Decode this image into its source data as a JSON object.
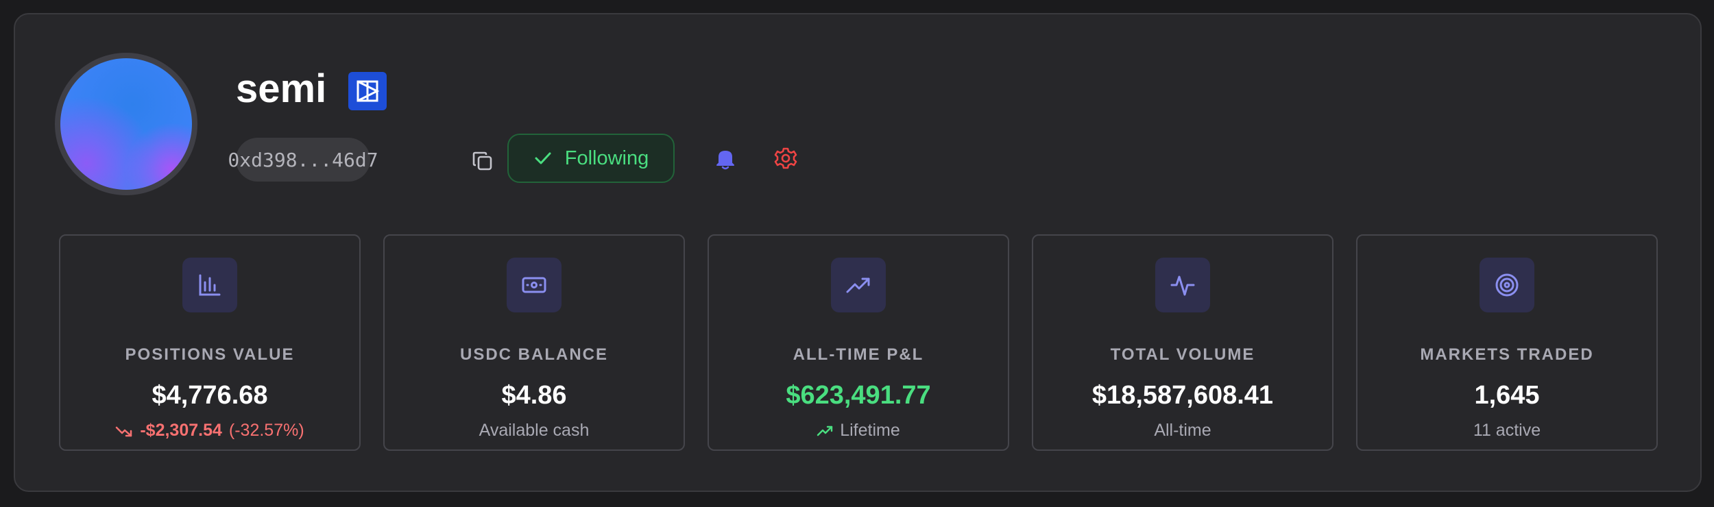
{
  "profile": {
    "name": "semi",
    "address": "0xd398...46d7",
    "follow_label": "Following",
    "icons": {
      "badge": "verified-platform-icon",
      "copy": "copy-icon",
      "follow_check": "check-icon",
      "notify": "bell-icon",
      "settings": "gear-icon"
    }
  },
  "stats": [
    {
      "icon": "bar-chart-icon",
      "label": "POSITIONS VALUE",
      "value": "$4,776.68",
      "change_amount": "-$2,307.54",
      "change_percent": "(-32.57%)",
      "change_icon": "trending-down-icon"
    },
    {
      "icon": "banknote-icon",
      "label": "USDC BALANCE",
      "value": "$4.86",
      "sub": "Available cash"
    },
    {
      "icon": "trending-up-icon",
      "label": "ALL-TIME P&L",
      "value": "$623,491.77",
      "sub": "Lifetime",
      "sub_icon": "trending-up-icon"
    },
    {
      "icon": "activity-icon",
      "label": "TOTAL VOLUME",
      "value": "$18,587,608.41",
      "sub": "All-time"
    },
    {
      "icon": "target-icon",
      "label": "MARKETS TRADED",
      "value": "1,645",
      "sub": "11 active"
    }
  ],
  "colors": {
    "accent": "#6366f1",
    "positive": "#4ade80",
    "negative": "#f87171",
    "settings": "#ef4444",
    "badge": "#1d4ed8"
  }
}
